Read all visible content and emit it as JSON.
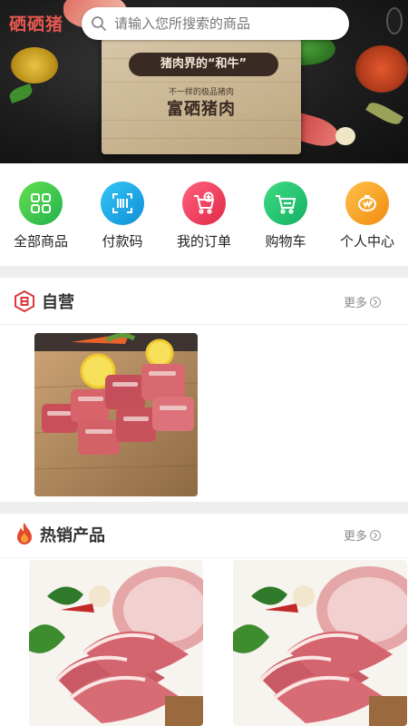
{
  "header": {
    "brand": "硒硒猪",
    "search_placeholder": "请输入您所搜索的商品"
  },
  "banner": {
    "ribbon": "猪肉界的“和牛”",
    "tagline": "不一样的极品猪肉",
    "title": "富硒猪肉"
  },
  "quick_nav": [
    {
      "label": "全部商品",
      "icon": "grid-icon",
      "color": "#34c552"
    },
    {
      "label": "付款码",
      "icon": "barcode-icon",
      "color": "#1ba3e6"
    },
    {
      "label": "我的订单",
      "icon": "cart-add-icon",
      "color": "#ee3b55"
    },
    {
      "label": "购物车",
      "icon": "cart-icon",
      "color": "#21c16e"
    },
    {
      "label": "个人中心",
      "icon": "piggy-bank-icon",
      "color": "#f7a21b"
    }
  ],
  "self_operated": {
    "title": "自营",
    "more": "更多",
    "icon": "self-operated-badge-icon",
    "accent": "#d9383d"
  },
  "hot_products": {
    "title": "热销产品",
    "more": "更多",
    "icon": "flame-icon",
    "accent": "#e24a2f"
  }
}
